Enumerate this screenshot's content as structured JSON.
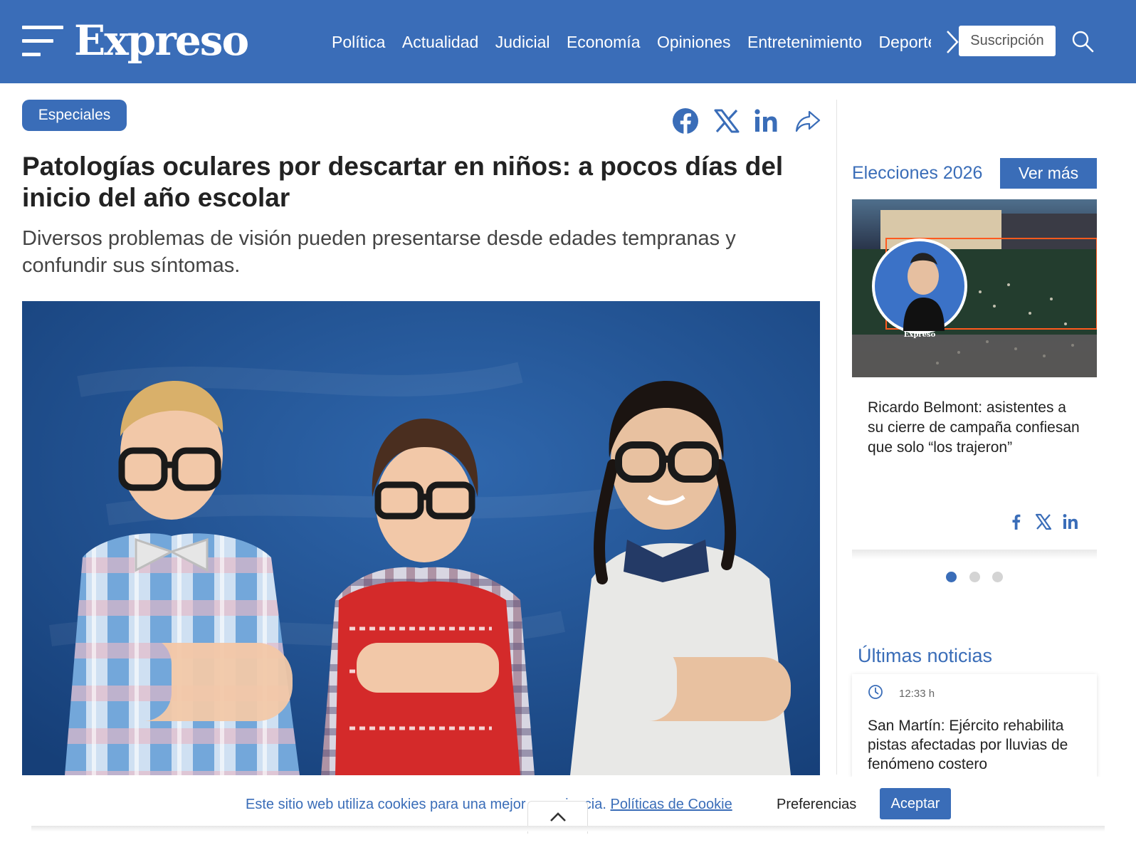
{
  "header": {
    "logo": "Expreso",
    "nav": [
      "Política",
      "Actualidad",
      "Judicial",
      "Economía",
      "Opiniones",
      "Entretenimiento",
      "Deportes"
    ],
    "subscribe_label": "Suscripción"
  },
  "article": {
    "category": "Especiales",
    "title": "Patologías oculares por descartar en niños: a pocos días del inicio del año escolar",
    "subtitle": "Diversos problemas de visión pueden presentarse desde edades tempranas y confundir sus síntomas."
  },
  "sidebar": {
    "section_title": "Elecciones 2026",
    "see_more_label": "Ver más",
    "featured": {
      "image_watermark": "Expreso",
      "headline": "Ricardo Belmont: asistentes a su cierre de campaña confiesan que solo “los trajeron”"
    },
    "carousel_active_index": 0,
    "latest": {
      "title": "Últimas noticias",
      "items": [
        {
          "time": "12:33 h",
          "headline": "San Martín: Ejército rehabilita pistas afectadas por lluvias de fenómeno costero"
        }
      ]
    }
  },
  "cookie": {
    "text": "Este sitio web utiliza cookies para una mejor experiencia.",
    "link": "Políticas de Cookie",
    "preferences_label": "Preferencias",
    "accept_label": "Aceptar"
  },
  "colors": {
    "brand_blue": "#3a6db8",
    "text_dark": "#222222"
  },
  "icons": [
    "menu-icon",
    "chevron-right-icon",
    "search-icon",
    "facebook-icon",
    "x-icon",
    "linkedin-icon",
    "share-icon",
    "clock-icon",
    "chevron-up-icon"
  ]
}
